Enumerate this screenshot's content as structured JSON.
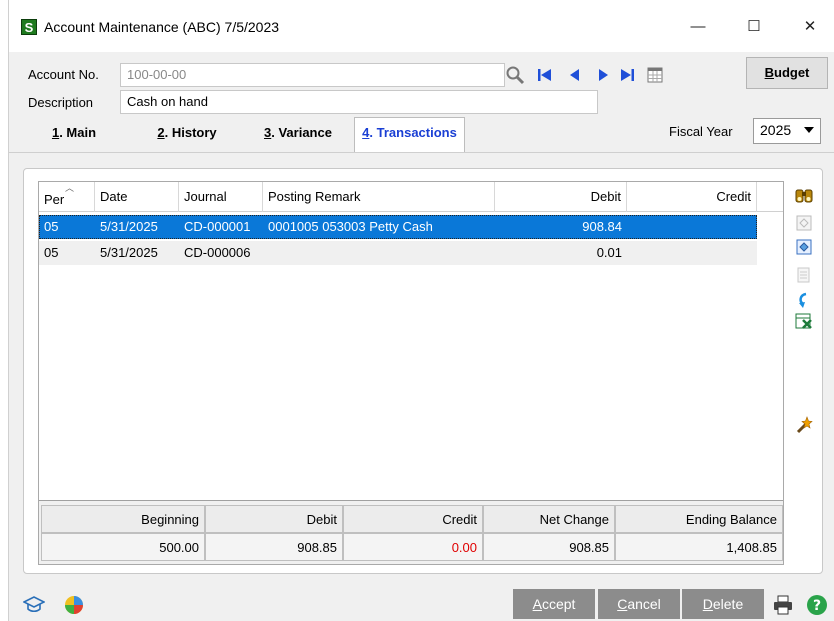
{
  "window": {
    "app_icon_letter": "S",
    "title": "Account Maintenance (ABC) 7/5/2023",
    "minimize": "—",
    "maximize": "☐",
    "close": "✕"
  },
  "header": {
    "account_label": "Account No.",
    "account_value": "100-00-00",
    "description_label": "Description",
    "description_value": "Cash on hand",
    "budget_letter": "B",
    "budget_rest": "udget",
    "fiscal_year_label": "Fiscal Year",
    "fiscal_year_value": "2025"
  },
  "tabs": [
    {
      "num": "1",
      "label": ". Main"
    },
    {
      "num": "2",
      "label": ". History"
    },
    {
      "num": "3",
      "label": ". Variance"
    },
    {
      "num": "4",
      "label": ". Transactions"
    }
  ],
  "grid": {
    "columns": [
      "Per",
      "Date",
      "Journal",
      "Posting Remark",
      "Debit",
      "Credit"
    ],
    "rows": [
      {
        "per": "05",
        "date": "5/31/2025",
        "journal": "CD-000001",
        "remark": "0001005 053003 Petty Cash",
        "debit": "908.84",
        "credit": ""
      },
      {
        "per": "05",
        "date": "5/31/2025",
        "journal": "CD-000006",
        "remark": "",
        "debit": "0.01",
        "credit": ""
      }
    ]
  },
  "totals": {
    "headers": [
      "Beginning",
      "Debit",
      "Credit",
      "Net Change",
      "Ending Balance"
    ],
    "values": [
      "500.00",
      "908.85",
      "0.00",
      "908.85",
      "1,408.85"
    ]
  },
  "buttons": {
    "accept_letter": "A",
    "accept_rest": "ccept",
    "cancel_letter": "C",
    "cancel_rest": "ancel",
    "delete_letter": "D",
    "delete_rest": "elete"
  },
  "colors": {
    "selection": "#0a78d8",
    "active_tab": "#1a3fd4",
    "credit_total": "#e00000",
    "nav_arrow": "#1f4fd8"
  }
}
